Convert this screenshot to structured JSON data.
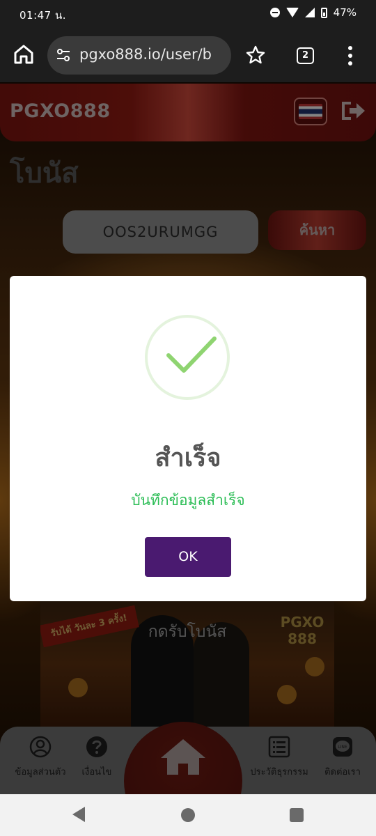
{
  "status_bar": {
    "time": "01:47 น.",
    "battery": "47%"
  },
  "browser": {
    "url": "pgxo888.io/user/b",
    "tab_count": "2"
  },
  "app": {
    "brand": "PGXO888",
    "page_title": "โบนัส",
    "code_value": "OOS2URUMGG",
    "search_label": "ค้นหา",
    "banner": {
      "claim_label": "กดรับโบนัส",
      "badge_text": "รับได้ วันละ 3 ครั้ง!",
      "logo_text": "PGXO 888"
    }
  },
  "modal": {
    "title": "สำเร็จ",
    "message": "บันทึกข้อมูลสำเร็จ",
    "ok_label": "OK"
  },
  "bottom_nav": {
    "items": [
      {
        "label": "ข้อมูลส่วนตัว"
      },
      {
        "label": "เงื่อนไข"
      },
      {
        "label": "ประวัติธุรกรรม"
      },
      {
        "label": "ติดต่อเรา"
      }
    ]
  },
  "colors": {
    "accent": "#8c1a12",
    "ok_button": "#4a1a70",
    "success_text": "#2bbd55"
  }
}
